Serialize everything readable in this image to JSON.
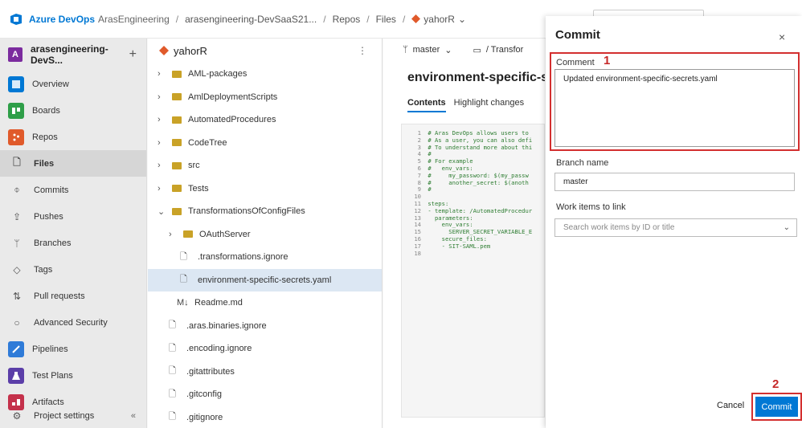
{
  "topbar": {
    "brand": "Azure DevOps",
    "org": "ArasEngineering",
    "project_crumb": "arasengineering-DevSaaS21...",
    "repos_crumb": "Repos",
    "files_crumb": "Files",
    "repo_crumb": "yahorR",
    "separator": "/"
  },
  "leftnav": {
    "project_badge": "A",
    "project_name": "arasengineering-DevS...",
    "plus": "+",
    "items": [
      {
        "label": "Overview",
        "icon": "overview-icon",
        "color": "#0078d4"
      },
      {
        "label": "Boards",
        "icon": "boards-icon",
        "color": "#2e9e48"
      },
      {
        "label": "Repos",
        "icon": "repos-icon",
        "color": "#e05a2b"
      },
      {
        "label": "Files",
        "icon": "files-icon"
      },
      {
        "label": "Commits",
        "icon": "commits-icon"
      },
      {
        "label": "Pushes",
        "icon": "pushes-icon"
      },
      {
        "label": "Branches",
        "icon": "branches-icon"
      },
      {
        "label": "Tags",
        "icon": "tags-icon"
      },
      {
        "label": "Pull requests",
        "icon": "pull-requests-icon"
      },
      {
        "label": "Advanced Security",
        "icon": "shield-icon"
      },
      {
        "label": "Pipelines",
        "icon": "pipelines-icon",
        "color": "#2f7bd8"
      },
      {
        "label": "Test Plans",
        "icon": "test-plans-icon",
        "color": "#5b3ea8"
      },
      {
        "label": "Artifacts",
        "icon": "artifacts-icon",
        "color": "#c4314b"
      }
    ],
    "footer": "Project settings",
    "collapse": "«"
  },
  "tree": {
    "repo_name": "yahorR",
    "items": [
      "AML-packages",
      "AmlDeploymentScripts",
      "AutomatedProcedures",
      "CodeTree",
      "src",
      "Tests",
      "TransformationsOfConfigFiles",
      "OAuthServer",
      ".transformations.ignore",
      "environment-specific-secrets.yaml",
      "Readme.md",
      ".aras.binaries.ignore",
      ".encoding.ignore",
      ".gitattributes",
      ".gitconfig",
      ".gitignore"
    ]
  },
  "editor": {
    "branch": "master",
    "path": "/ Transfor",
    "title": "environment-specific-secret",
    "tabs": [
      "Contents",
      "Highlight changes"
    ],
    "code_lines": [
      {
        "n": "1",
        "t": "# Aras DevOps allows users to"
      },
      {
        "n": "2",
        "t": "# As a user, you can also defi"
      },
      {
        "n": "3",
        "t": "# To understand more about thi"
      },
      {
        "n": "4",
        "t": "#"
      },
      {
        "n": "5",
        "t": "# For example"
      },
      {
        "n": "6",
        "t": "#   env_vars:"
      },
      {
        "n": "7",
        "t": "#     my_password: $(my_passw"
      },
      {
        "n": "8",
        "t": "#     another_secret: $(anoth"
      },
      {
        "n": "9",
        "t": "#"
      },
      {
        "n": "10",
        "t": ""
      },
      {
        "n": "11",
        "t": "steps:"
      },
      {
        "n": "12",
        "t": "- template: /AutomatedProcedur"
      },
      {
        "n": "13",
        "t": "  parameters:"
      },
      {
        "n": "14",
        "t": "    env_vars:"
      },
      {
        "n": "15",
        "t": "      SERVER_SECRET_VARIABLE_E"
      },
      {
        "n": "16",
        "t": "    secure_files:"
      },
      {
        "n": "17",
        "t": "    - SIT-SAML.pem"
      },
      {
        "n": "18",
        "t": ""
      }
    ]
  },
  "dialog": {
    "title": "Commit",
    "close": "×",
    "comment_label": "Comment",
    "comment_value": "Updated environment-specific-secrets.yaml",
    "annotation_1": "1",
    "branch_label": "Branch name",
    "branch_value": "master",
    "work_items_label": "Work items to link",
    "work_items_placeholder": "Search work items by ID or title",
    "annotation_2": "2",
    "cancel": "Cancel",
    "commit": "Commit"
  }
}
